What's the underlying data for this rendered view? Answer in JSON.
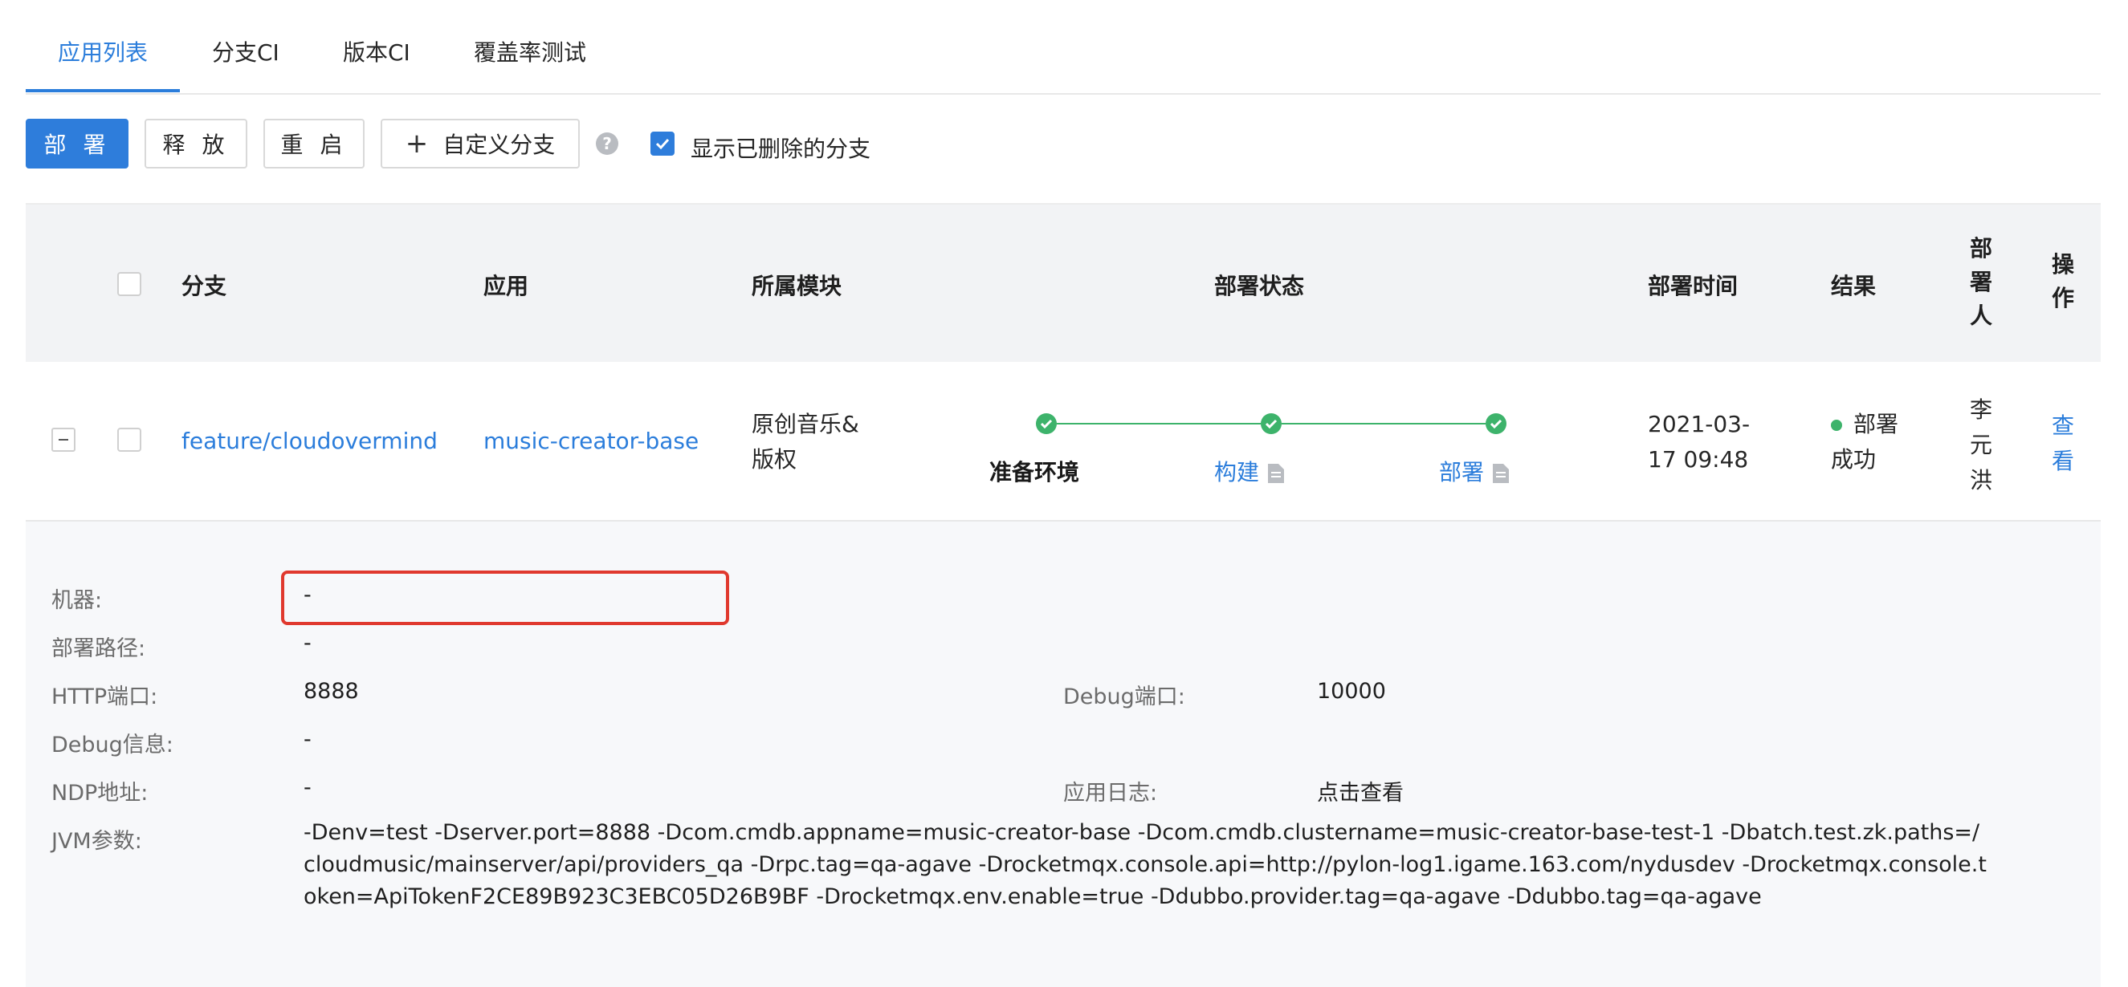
{
  "tabs": [
    "应用列表",
    "分支CI",
    "版本CI",
    "覆盖率测试"
  ],
  "toolbar": {
    "deploy": "部 署",
    "release": "释 放",
    "restart": "重 启",
    "custom_branch": "自定义分支",
    "show_deleted": "显示已删除的分支",
    "show_deleted_checked": true
  },
  "table": {
    "headers": {
      "branch": "分支",
      "app": "应用",
      "module": "所属模块",
      "status": "部署状态",
      "time": "部署时间",
      "result": "结果",
      "deployer": [
        "部",
        "署",
        "人"
      ],
      "ops": [
        "操",
        "作"
      ]
    },
    "row": {
      "branch": "feature/cloudovermind",
      "app": "music-creator-base",
      "module": [
        "原创音乐&",
        "版权"
      ],
      "steps": [
        "准备环境",
        "构建",
        "部署"
      ],
      "time": [
        "2021-03-",
        "17 09:48"
      ],
      "result": [
        "部署",
        "成功"
      ],
      "deployer": [
        "李",
        "元",
        "洪"
      ],
      "view": [
        "查",
        "看"
      ]
    }
  },
  "details": {
    "machine_label": "机器:",
    "machine_value": "-",
    "path_label": "部署路径:",
    "path_value": "-",
    "http_label": "HTTP端口:",
    "http_value": "8888",
    "debug_port_label": "Debug端口:",
    "debug_port_value": "10000",
    "debug_info_label": "Debug信息:",
    "debug_info_value": "-",
    "ndp_label": "NDP地址:",
    "ndp_value": "-",
    "log_label": "应用日志:",
    "log_value": "点击查看",
    "jvm_label": "JVM参数:",
    "jvm_value": "-Denv=test -Dserver.port=8888 -Dcom.cmdb.appname=music-creator-base -Dcom.cmdb.clustername=music-creator-base-test-1 -Dbatch.test.zk.paths=/cloudmusic/mainserver/api/providers_qa -Drpc.tag=qa-agave -Drocketmqx.console.api=http://pylon-log1.igame.163.com/nydusdev -Drocketmqx.console.token=ApiTokenF2CE89B923C3EBC05D26B9BF -Drocketmqx.env.enable=true -Ddubbo.provider.tag=qa-agave -Ddubbo.tag=qa-agave"
  },
  "colors": {
    "primary": "#2e7ddb",
    "success": "#3db36b",
    "highlight": "#e0392e"
  }
}
